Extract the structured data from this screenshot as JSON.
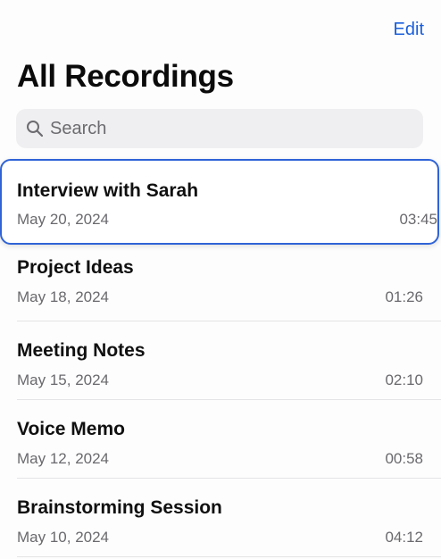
{
  "header": {
    "edit_label": "Edit",
    "title": "All Recordings"
  },
  "search": {
    "placeholder": "Search",
    "icon": "magnifying-glass"
  },
  "recordings": [
    {
      "name": "Interview with Sarah",
      "date": "May 20, 2024",
      "duration": "03:45",
      "selected": true
    },
    {
      "name": "Project Ideas",
      "date": "May 18, 2024",
      "duration": "01:26",
      "selected": false
    },
    {
      "name": "Meeting Notes",
      "date": "May 15, 2024",
      "duration": "02:10",
      "selected": false
    },
    {
      "name": "Voice Memo",
      "date": "May 12, 2024",
      "duration": "00:58",
      "selected": false
    },
    {
      "name": "Brainstorming Session",
      "date": "May 10, 2024",
      "duration": "04:12",
      "selected": false
    }
  ],
  "colors": {
    "accent": "#1a5fdc",
    "selection_border": "#2f63d6",
    "search_bg": "#efeff1",
    "secondary_text": "#6a6a6e"
  }
}
